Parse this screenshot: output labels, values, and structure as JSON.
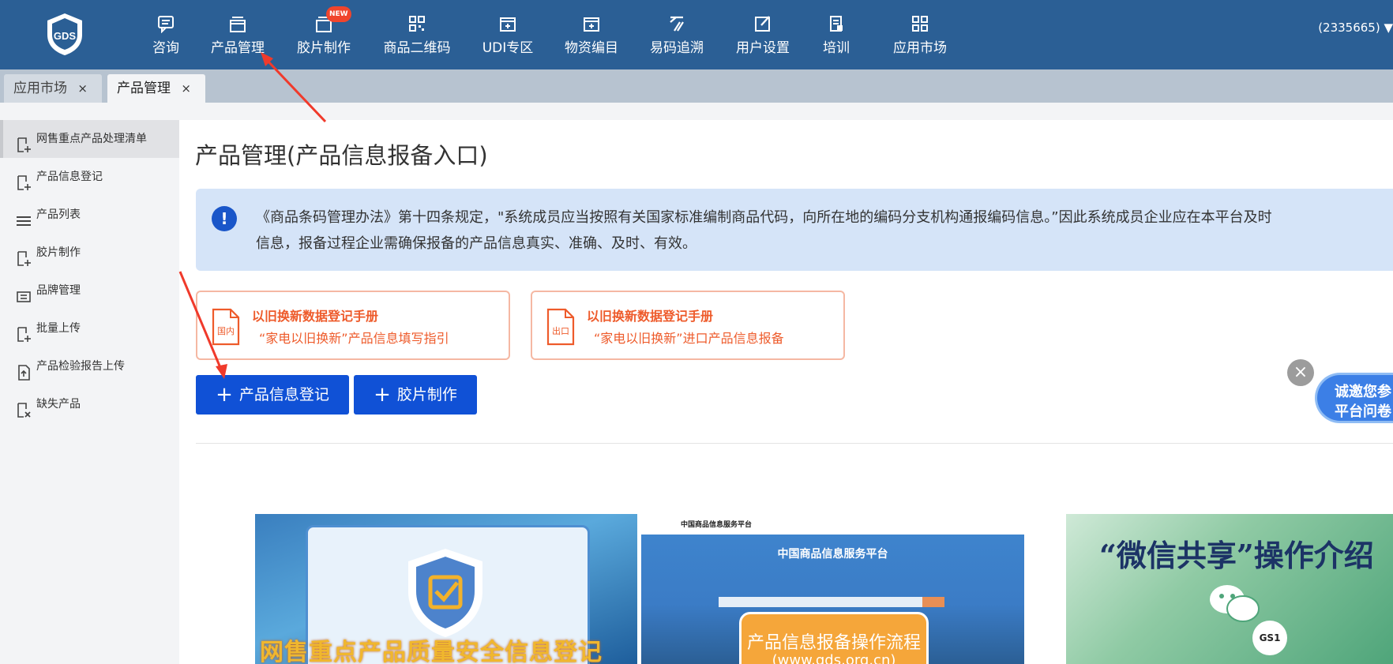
{
  "header": {
    "logo_text": "GDS",
    "nav": [
      {
        "label": "咨询",
        "icon": "chat-icon"
      },
      {
        "label": "产品管理",
        "icon": "product-box-icon"
      },
      {
        "label": "胶片制作",
        "icon": "film-icon",
        "badge": "NEW"
      },
      {
        "label": "商品二维码",
        "icon": "qr-code-icon"
      },
      {
        "label": "UDI专区",
        "icon": "udi-box-icon"
      },
      {
        "label": "物资编目",
        "icon": "catalog-box-icon"
      },
      {
        "label": "易码追溯",
        "icon": "trace-code-icon"
      },
      {
        "label": "用户设置",
        "icon": "edit-user-icon"
      },
      {
        "label": "培训",
        "icon": "training-doc-icon"
      },
      {
        "label": "应用市场",
        "icon": "app-grid-icon"
      }
    ],
    "account": "(2335665) ▼"
  },
  "tabs": [
    {
      "label": "应用市场",
      "close": "×",
      "active": false
    },
    {
      "label": "产品管理",
      "close": "×",
      "active": true
    }
  ],
  "sidebar": {
    "items": [
      {
        "label": "网售重点产品处理清单",
        "icon": "doc-add-icon",
        "active": true
      },
      {
        "label": "产品信息登记",
        "icon": "doc-add-icon"
      },
      {
        "label": "产品列表",
        "icon": "list-icon"
      },
      {
        "label": "胶片制作",
        "icon": "doc-add-icon"
      },
      {
        "label": "品牌管理",
        "icon": "brand-icon"
      },
      {
        "label": "批量上传",
        "icon": "doc-add-icon"
      },
      {
        "label": "产品检验报告上传",
        "icon": "doc-upload-icon"
      },
      {
        "label": "缺失产品",
        "icon": "doc-missing-icon"
      }
    ]
  },
  "main": {
    "title": "产品管理(产品信息报备入口)",
    "notice": {
      "icon": "!",
      "line1": "《商品条码管理办法》第十四条规定，\"系统成员应当按照有关国家标准编制商品代码，向所在地的编码分支机构通报编码信息。”因此系统成员企业应在本平台及时",
      "line2": "信息，报备过程企业需确保报备的产品信息真实、准确、及时、有效。"
    },
    "manuals": [
      {
        "title": "以旧换新数据登记手册",
        "subtitle": "“家电以旧换新”产品信息填写指引",
        "badge": "国内"
      },
      {
        "title": "以旧换新数据登记手册",
        "subtitle": "“家电以旧换新”进口产品信息报备",
        "badge": "出口"
      }
    ],
    "buttons": {
      "plus": "+",
      "register": "产品信息登记",
      "film": "胶片制作"
    },
    "popup": {
      "close": "×",
      "line1": "诚邀您参",
      "line2": "平台问卷"
    },
    "banners": {
      "b1_caption": "网售重点产品质量安全信息登记",
      "b2_site": "中国商品信息服务平台",
      "b2_hero": "中国商品信息服务平台",
      "b2_flow_title": "产品信息报备操作流程",
      "b2_flow_url": "(www.gds.org.cn)",
      "b3_title": "“微信共享”操作介绍",
      "b3_logo": "GS1"
    }
  },
  "colors": {
    "topbar": "#2b5f95",
    "primary_button": "#1051d6",
    "notice_bg": "#d5e4f8",
    "manual_orange": "#ee5b2b",
    "sidebar_bg": "#f3f4f6"
  }
}
